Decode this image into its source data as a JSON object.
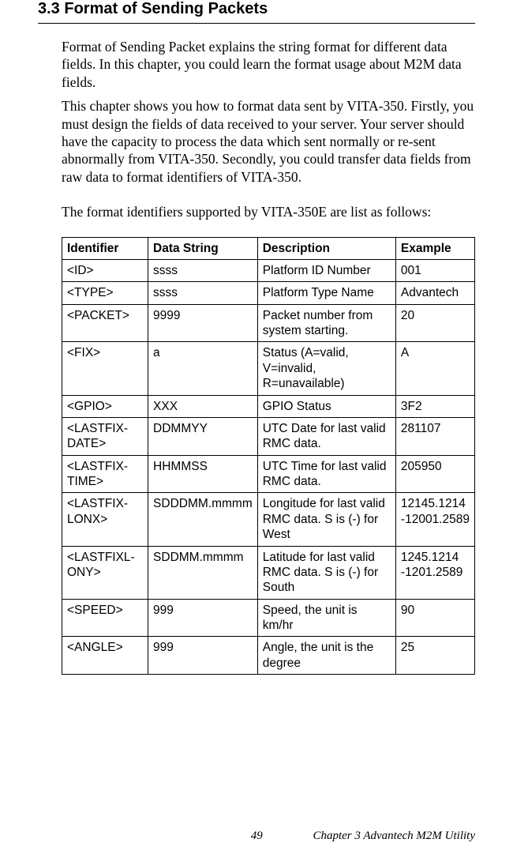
{
  "heading": "3.3  Format of Sending Packets",
  "para1": "Format of Sending Packet explains the string format for different data fields. In this chapter, you could learn the format usage about M2M data fields.",
  "para2": "This chapter shows you how to format data sent by VITA-350. Firstly, you must design the fields of data received to your server. Your server should have the capacity to process the data which sent normally or re-sent abnormally from VITA-350. Secondly, you could transfer data fields from raw data to format identifiers of VITA-350.",
  "para3": "The format identifiers supported by VITA-350E are list as follows:",
  "table": {
    "headers": [
      "Identifier",
      "Data String",
      "Description",
      "Example"
    ],
    "rows": [
      {
        "c0": "<ID>",
        "c1": "ssss",
        "c2": "Platform ID Number",
        "c3": "001"
      },
      {
        "c0": "<TYPE>",
        "c1": "ssss",
        "c2": "Platform Type Name",
        "c3": "Advantech"
      },
      {
        "c0": "<PACKET>",
        "c1": "9999",
        "c2": "Packet number from system starting.",
        "c3": "20"
      },
      {
        "c0": "<FIX>",
        "c1": "a",
        "c2": "Status (A=valid, V=invalid, R=unavailable)",
        "c3": "A"
      },
      {
        "c0": "<GPIO>",
        "c1": "XXX",
        "c2": "GPIO Status",
        "c3": "3F2"
      },
      {
        "c0": "<LASTFIX-DATE>",
        "c1": "DDMMYY",
        "c2": "UTC Date for last valid RMC data.",
        "c3": "281107"
      },
      {
        "c0": "<LASTFIX-TIME>",
        "c1": "HHMMSS",
        "c2": "UTC Time for last valid RMC data.",
        "c3": "205950"
      },
      {
        "c0": "<LASTFIX-LONX>",
        "c1": "SDDDMM.mmmm",
        "c2": "Longitude for last valid RMC data. S is (-) for West",
        "c3": "12145.1214\n-12001.2589"
      },
      {
        "c0": "<LASTFIXL-ONY>",
        "c1": "SDDMM.mmmm",
        "c2": "Latitude for last valid RMC data. S is (-) for South",
        "c3": "1245.1214\n-1201.2589"
      },
      {
        "c0": "<SPEED>",
        "c1": "999",
        "c2": "Speed, the unit is km/hr",
        "c3": "90"
      },
      {
        "c0": "<ANGLE>",
        "c1": "999",
        "c2": "Angle, the unit is the degree",
        "c3": "25"
      }
    ]
  },
  "footer": {
    "page": "49",
    "chapter": "Chapter 3  Advantech M2M Utility"
  }
}
